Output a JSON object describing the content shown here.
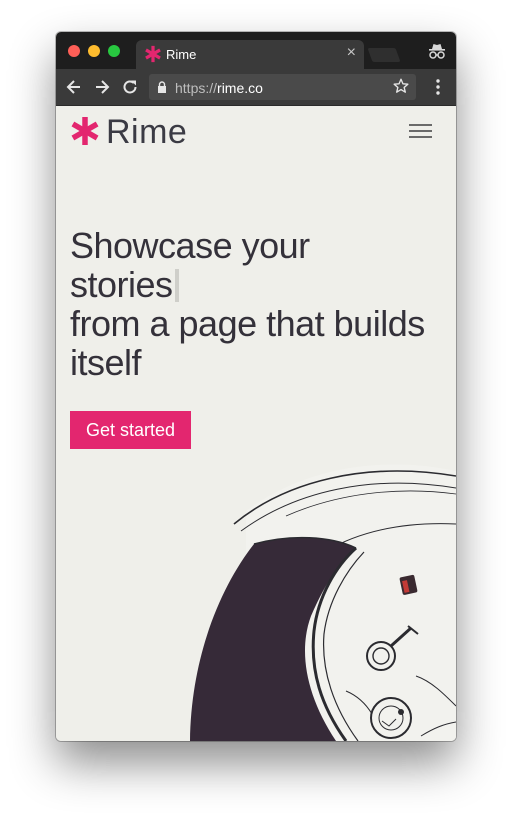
{
  "browser": {
    "tab": {
      "title": "Rime",
      "close_glyph": "×"
    },
    "address": {
      "scheme": "https://",
      "host": "rime.co"
    },
    "icons": [
      "back-icon",
      "forward-icon",
      "reload-icon",
      "lock-icon",
      "star-icon",
      "menu-icon",
      "incognito-icon"
    ]
  },
  "site": {
    "brand": "Rime",
    "headline": {
      "line1": "Showcase your",
      "line2": "stories",
      "line3": "from a page that builds",
      "line4": "itself"
    },
    "cta_label": "Get started"
  },
  "colors": {
    "accent": "#e3266f",
    "page_bg": "#efefea",
    "text": "#34313a",
    "helmet_visor": "#362a38"
  }
}
